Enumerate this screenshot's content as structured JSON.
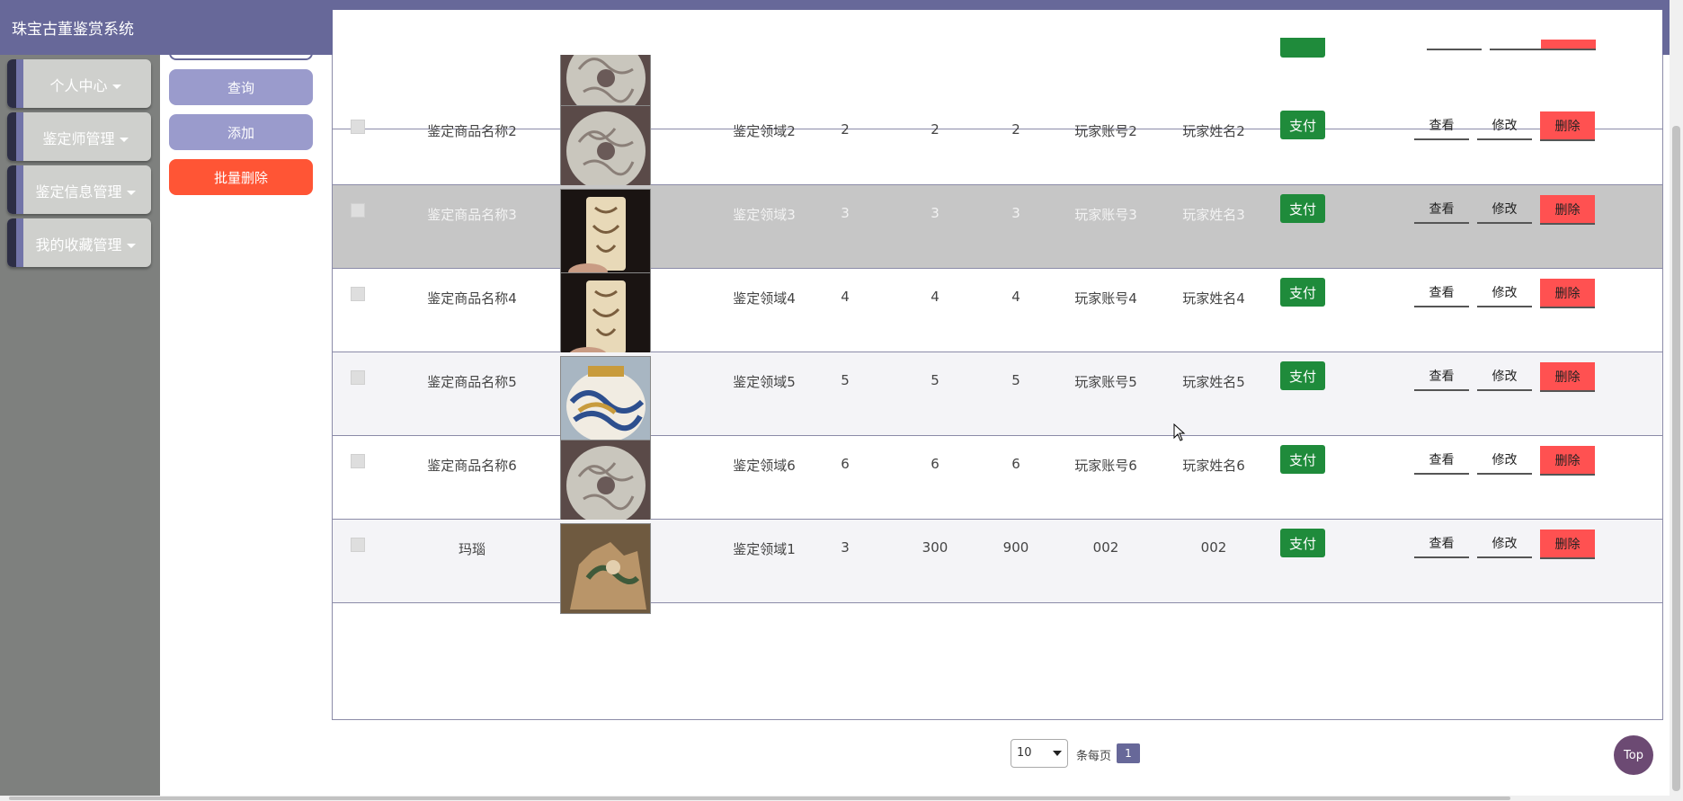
{
  "app": {
    "title": "珠宝古董鉴赏系统"
  },
  "sidebar": {
    "items": [
      {
        "label": "个人中心"
      },
      {
        "label": "鉴定师管理"
      },
      {
        "label": "鉴定信息管理"
      },
      {
        "label": "我的收藏管理"
      }
    ]
  },
  "actions": {
    "query": "查询",
    "add": "添加",
    "batch_delete": "批量删除"
  },
  "row_actions": {
    "pay": "支付",
    "view": "查看",
    "edit": "修改",
    "delete": "删除"
  },
  "rows": [
    {
      "name": "鉴定商品名称2",
      "image": "jade-disc-image",
      "field": "鉴定领域2",
      "c1": "2",
      "c2": "2",
      "c3": "2",
      "account": "玩家账号2",
      "player": "玩家姓名2"
    },
    {
      "name": "鉴定商品名称3",
      "image": "jade-carving-image",
      "field": "鉴定领域3",
      "c1": "3",
      "c2": "3",
      "c3": "3",
      "account": "玩家账号3",
      "player": "玩家姓名3"
    },
    {
      "name": "鉴定商品名称4",
      "image": "jade-carving-image",
      "field": "鉴定领域4",
      "c1": "4",
      "c2": "4",
      "c3": "4",
      "account": "玩家账号4",
      "player": "玩家姓名4"
    },
    {
      "name": "鉴定商品名称5",
      "image": "porcelain-jar-image",
      "field": "鉴定领域5",
      "c1": "5",
      "c2": "5",
      "c3": "5",
      "account": "玩家账号5",
      "player": "玩家姓名5"
    },
    {
      "name": "鉴定商品名称6",
      "image": "jade-disc-image",
      "field": "鉴定领域6",
      "c1": "6",
      "c2": "6",
      "c3": "6",
      "account": "玩家账号6",
      "player": "玩家姓名6"
    },
    {
      "name": "玛瑙",
      "image": "agate-sculpture-image",
      "field": "鉴定领域1",
      "c1": "3",
      "c2": "300",
      "c3": "900",
      "account": "002",
      "player": "002"
    }
  ],
  "pagination": {
    "page_size": "10",
    "per_page_label": "条每页",
    "current_page": "1"
  },
  "top_button": "Top",
  "colors": {
    "header": "#676899",
    "pay": "#1f8b3b",
    "delete": "#ff5151",
    "batch_delete": "#ff5535",
    "button": "#9a9bcc"
  }
}
